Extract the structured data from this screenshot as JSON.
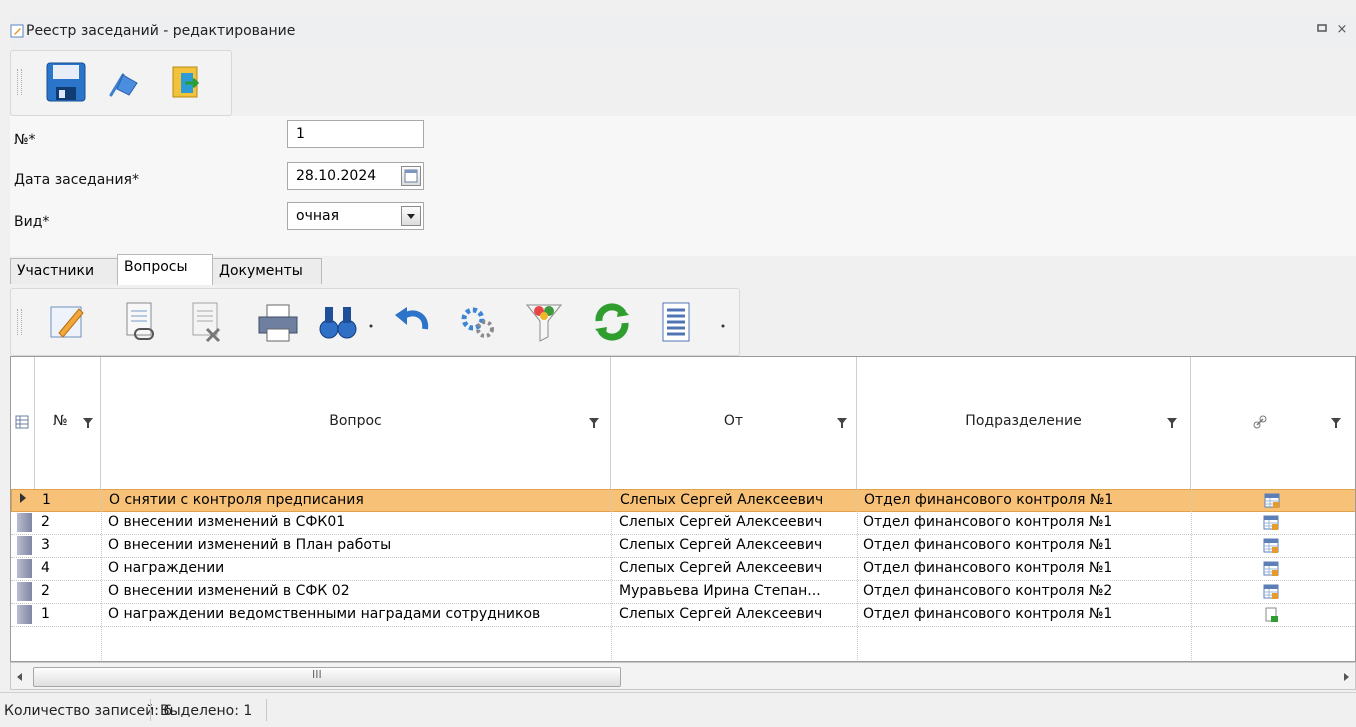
{
  "window": {
    "title": "Реестр заседаний - редактирование"
  },
  "form": {
    "number_label": "№*",
    "number_value": "1",
    "date_label": "Дата заседания*",
    "date_value": "28.10.2024",
    "type_label": "Вид*",
    "type_value": "очная"
  },
  "tabs": [
    {
      "label": "Участники"
    },
    {
      "label": "Вопросы"
    },
    {
      "label": "Документы"
    }
  ],
  "table": {
    "columns": [
      "№",
      "Вопрос",
      "От",
      "Подразделение"
    ],
    "rows": [
      {
        "num": "1",
        "question": "О снятии с контроля предписания",
        "from": "Слепых Сергей Алексеевич",
        "department": "Отдел финансового контроля №1",
        "icon": "table-link-icon"
      },
      {
        "num": "2",
        "question": "О внесении изменений в СФК01",
        "from": "Слепых Сергей Алексеевич",
        "department": "Отдел финансового контроля №1",
        "icon": "table-link-icon"
      },
      {
        "num": "3",
        "question": "О внесении изменений в План работы",
        "from": "Слепых Сергей Алексеевич",
        "department": "Отдел финансового контроля №1",
        "icon": "table-link-icon"
      },
      {
        "num": "4",
        "question": "О награждении",
        "from": "Слепых Сергей Алексеевич",
        "department": "Отдел финансового контроля №1",
        "icon": "table-link-icon"
      },
      {
        "num": "2",
        "question": "О внесении изменений в СФК 02",
        "from": "Муравьева Ирина Степан...",
        "department": "Отдел финансового контроля №2",
        "icon": "table-link-icon"
      },
      {
        "num": "1",
        "question": "О награждении ведомственными наградами сотрудников",
        "from": "Слепых Сергей Алексеевич",
        "department": "Отдел финансового контроля №1",
        "icon": "document-link-icon"
      }
    ]
  },
  "status": {
    "count": "Количество записей: 6",
    "selected": "Выделено: 1"
  },
  "scroll": {
    "grip": "III"
  },
  "colors": {
    "selected_row": "#f7c277",
    "accent_blue": "#2c6fc5",
    "green": "#2f9e2f"
  }
}
